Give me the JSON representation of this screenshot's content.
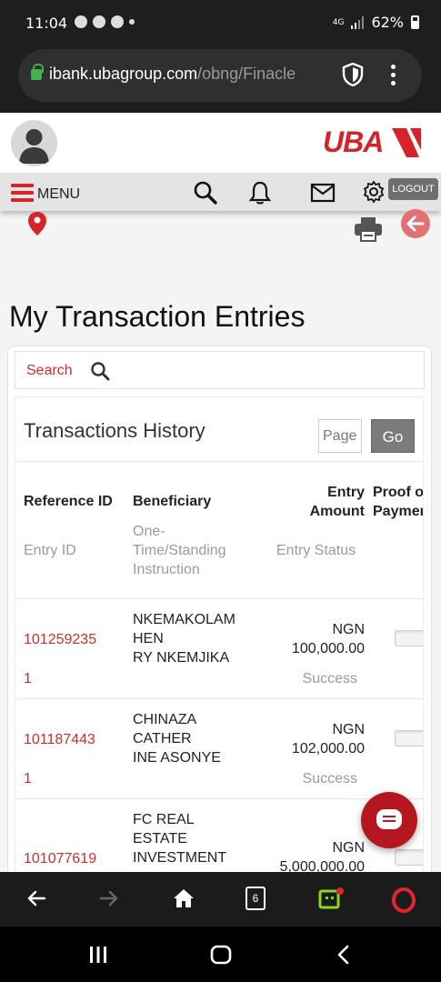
{
  "status_bar": {
    "time": "11:04",
    "network": "4G",
    "battery": "62%"
  },
  "browser": {
    "url_host": "ibank.ubagroup.com",
    "url_path": "/obng/Finacle",
    "tab_count": "6"
  },
  "header": {
    "brand": "UBA",
    "menu_label": "MENU",
    "logout_label": "LOGOUT"
  },
  "page": {
    "title": "My Transaction Entries",
    "search_label": "Search",
    "panel_title": "Transactions History",
    "page_placeholder": "Page",
    "go_label": "Go"
  },
  "table": {
    "headers": {
      "reference_id": "Reference ID",
      "beneficiary": "Beneficiary",
      "entry_amount_1": "Entry",
      "entry_amount_2": "Amount",
      "proof_1": "Proof o",
      "proof_2": "Paymer"
    },
    "subheaders": {
      "entry_id": "Entry ID",
      "instruction_1": "One-",
      "instruction_2": "Time/Standing",
      "instruction_3": "Instruction",
      "entry_status": "Entry Status"
    },
    "rows": [
      {
        "reference_id": "101259235",
        "entry_id": "1",
        "beneficiary": [
          "NKEMAKOLAM",
          "HEN",
          "RY NKEMJIKA"
        ],
        "currency": "NGN",
        "amount": "100,000.00",
        "status": "Success"
      },
      {
        "reference_id": "101187443",
        "entry_id": "1",
        "beneficiary": [
          "CHINAZA",
          "CATHER",
          "INE ASONYE"
        ],
        "currency": "NGN",
        "amount": "102,000.00",
        "status": "Success"
      },
      {
        "reference_id": "101077619",
        "entry_id": "",
        "beneficiary": [
          "FC REAL",
          "ESTATE",
          "INVESTMENT"
        ],
        "currency": "NGN",
        "amount": "5,000,000.00",
        "status": ""
      }
    ]
  },
  "colors": {
    "brand_red": "#d6232a",
    "link_red": "#c9302c",
    "muted": "#9a9a9a"
  }
}
